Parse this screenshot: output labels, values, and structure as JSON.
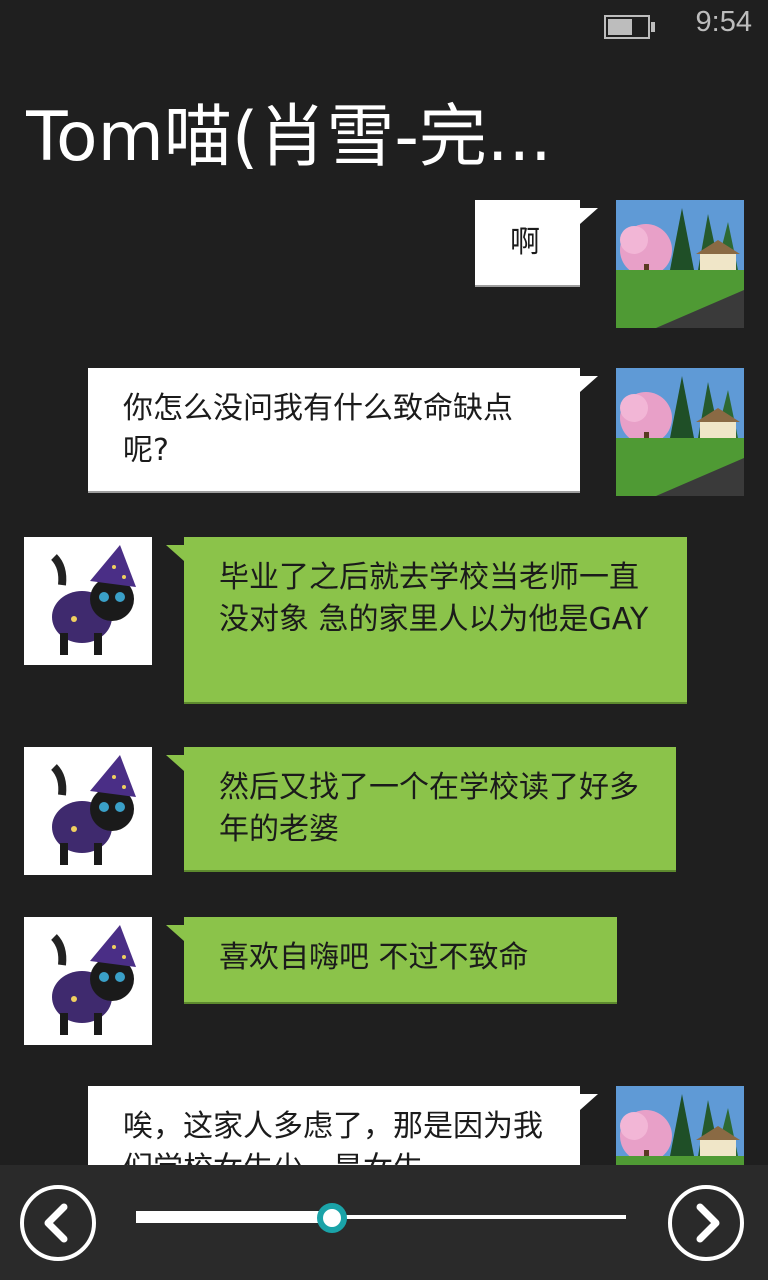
{
  "status": {
    "time": "9:54",
    "battery_level": 0.62
  },
  "title": "Tom喵(肖雪-完...",
  "messages": [
    {
      "side": "out",
      "text": "啊"
    },
    {
      "side": "out",
      "text": "你怎么没问我有什么致命缺点呢?"
    },
    {
      "side": "in",
      "text": "毕业了之后就去学校当老师一直没对象 急的家里人以为他是GAY"
    },
    {
      "side": "in",
      "text": "然后又找了一个在学校读了好多年的老婆"
    },
    {
      "side": "in",
      "text": "喜欢自嗨吧 不过不致命"
    },
    {
      "side": "out",
      "text": "唉，这家人多虑了，那是因为我们学校女生少，是女生"
    }
  ],
  "player": {
    "progress": 0.4
  },
  "icons": {
    "prev": "chevron-left-icon",
    "next": "chevron-right-icon"
  },
  "colors": {
    "incoming": "#8bc34a",
    "outgoing": "#ffffff",
    "accent": "#1aa3a8",
    "background": "#1f1f1f"
  }
}
